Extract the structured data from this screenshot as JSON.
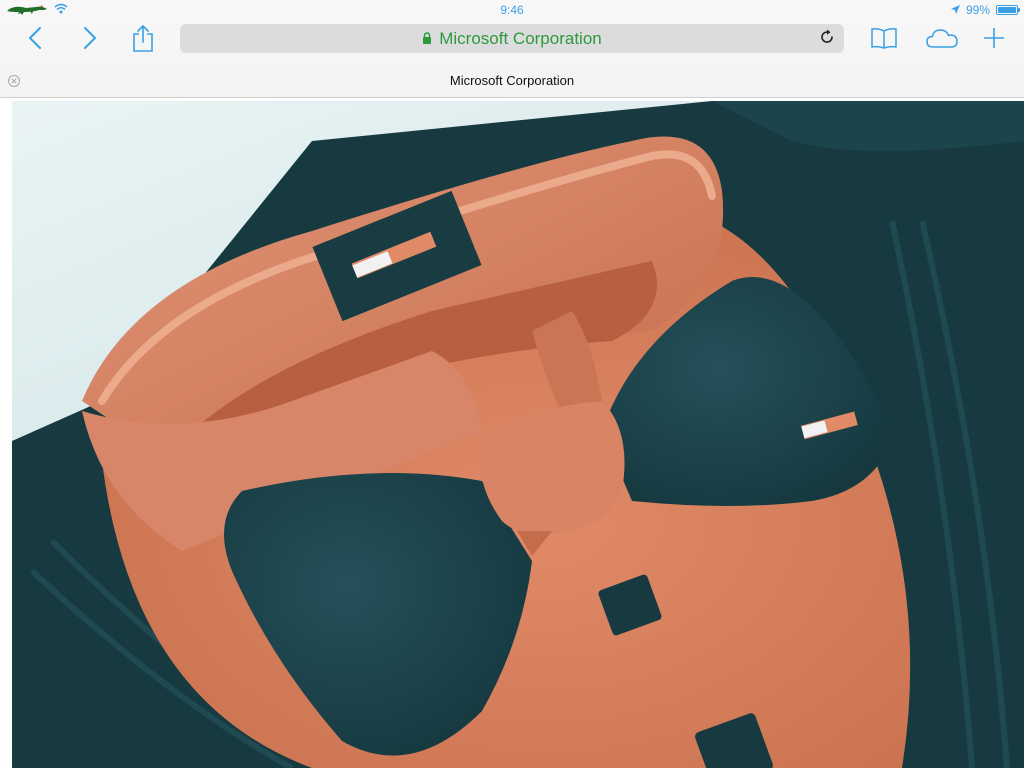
{
  "status_bar": {
    "time": "9:46",
    "battery_percent": "99%",
    "battery_level": 0.99,
    "carrier_icon": "crocodile-logo-icon",
    "wifi_icon": "wifi-icon",
    "location_icon": "location-arrow-icon"
  },
  "toolbar": {
    "back_icon": "chevron-left-icon",
    "forward_icon": "chevron-right-icon",
    "share_icon": "share-icon",
    "bookmarks_icon": "book-icon",
    "cloud_tabs_icon": "cloud-icon",
    "new_tab_icon": "plus-icon",
    "address": {
      "text": "Microsoft Corporation",
      "secure": true,
      "lock_icon": "lock-icon",
      "reload_icon": "reload-icon"
    }
  },
  "tab": {
    "title": "Microsoft Corporation",
    "close_icon": "close-circle-icon"
  },
  "colors": {
    "accent": "#3b9fe6",
    "secure_green": "#2e9a3c",
    "fabric_dark": "#173a3f",
    "fondant_orange": "#d9805f"
  }
}
